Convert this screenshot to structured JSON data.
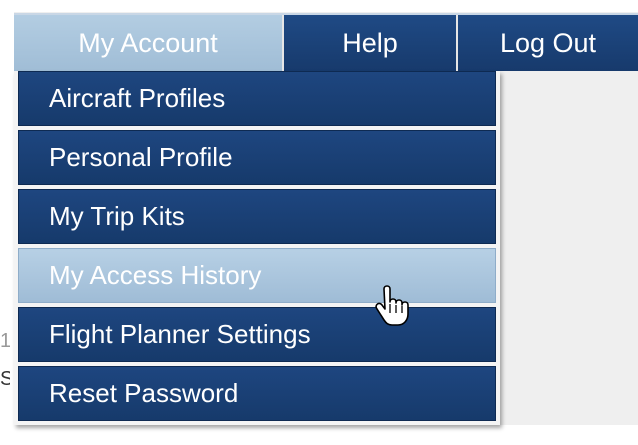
{
  "nav": {
    "account_label": "My Account",
    "help_label": "Help",
    "logout_label": "Log Out"
  },
  "menu": {
    "items": [
      {
        "label": "Aircraft Profiles"
      },
      {
        "label": "Personal Profile"
      },
      {
        "label": "My Trip Kits"
      },
      {
        "label": "My Access History"
      },
      {
        "label": "Flight Planner Settings"
      },
      {
        "label": "Reset Password"
      }
    ],
    "hovered": "My Access History"
  },
  "colors": {
    "nav_bg": "#1f4a85",
    "active_bg": "#b3cde2",
    "page_bg": "#efefef"
  },
  "peek": {
    "line1": "1",
    "line2": "S"
  },
  "cursor": {
    "icon": "hand-pointer-icon"
  }
}
